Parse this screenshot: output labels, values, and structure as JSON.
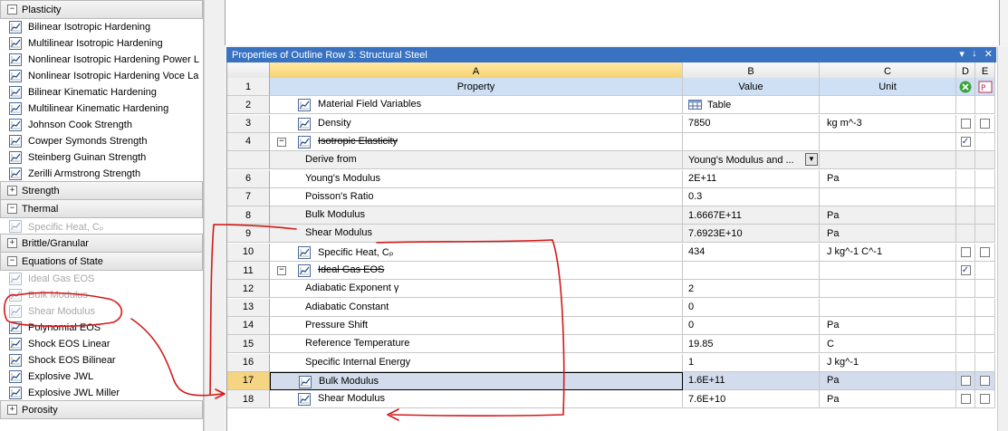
{
  "toolbox": {
    "items": [
      {
        "kind": "group",
        "label": "Plasticity",
        "expanded": true
      },
      {
        "kind": "item",
        "label": "Bilinear Isotropic Hardening"
      },
      {
        "kind": "item",
        "label": "Multilinear Isotropic Hardening"
      },
      {
        "kind": "item",
        "label": "Nonlinear Isotropic Hardening Power L"
      },
      {
        "kind": "item",
        "label": "Nonlinear Isotropic Hardening Voce La"
      },
      {
        "kind": "item",
        "label": "Bilinear Kinematic Hardening"
      },
      {
        "kind": "item",
        "label": "Multilinear Kinematic Hardening"
      },
      {
        "kind": "item",
        "label": "Johnson Cook Strength"
      },
      {
        "kind": "item",
        "label": "Cowper Symonds Strength"
      },
      {
        "kind": "item",
        "label": "Steinberg Guinan Strength"
      },
      {
        "kind": "item",
        "label": "Zerilli Armstrong Strength"
      },
      {
        "kind": "group",
        "label": "Strength",
        "expanded": false
      },
      {
        "kind": "group",
        "label": "Thermal",
        "expanded": true
      },
      {
        "kind": "item",
        "label": "Specific Heat, Cₚ",
        "disabled": true
      },
      {
        "kind": "group",
        "label": "Brittle/Granular",
        "expanded": false
      },
      {
        "kind": "group",
        "label": "Equations of State",
        "expanded": true
      },
      {
        "kind": "item",
        "label": "Ideal Gas EOS",
        "disabled": true
      },
      {
        "kind": "item",
        "label": "Bulk Modulus",
        "disabled": true
      },
      {
        "kind": "item",
        "label": "Shear Modulus",
        "disabled": true
      },
      {
        "kind": "item",
        "label": "Polynomial EOS"
      },
      {
        "kind": "item",
        "label": "Shock EOS Linear"
      },
      {
        "kind": "item",
        "label": "Shock EOS Bilinear"
      },
      {
        "kind": "item",
        "label": "Explosive JWL"
      },
      {
        "kind": "item",
        "label": "Explosive JWL Miller"
      },
      {
        "kind": "group",
        "label": "Porosity",
        "expanded": false
      }
    ]
  },
  "panel": {
    "title": "Properties of Outline Row 3: Structural Steel",
    "title_buttons": [
      "▾",
      " ↓ ",
      "✕"
    ]
  },
  "grid": {
    "column_letters": [
      "A",
      "B",
      "C",
      "D",
      "E"
    ],
    "rows": [
      {
        "num": "1",
        "property": "Property",
        "value": "Value",
        "unit": "Unit",
        "type": "header"
      },
      {
        "num": "2",
        "property": "Material Field Variables",
        "value": "Table",
        "unit": "",
        "icon": true,
        "value_icon": true,
        "type": "normal"
      },
      {
        "num": "3",
        "property": "Density",
        "value": "7850",
        "unit": "kg m^-3",
        "icon": true,
        "d": "box",
        "e": "box",
        "type": "normal"
      },
      {
        "num": "4",
        "property": "Isotropic Elasticity",
        "value": "",
        "unit": "",
        "icon": true,
        "toggle": "−",
        "strike": true,
        "d": "checked",
        "type": "normal"
      },
      {
        "num": "",
        "property": "Derive from",
        "value": "Young's Modulus and ...",
        "unit": "",
        "dropdown": true,
        "indent": true,
        "type": "alt"
      },
      {
        "num": "6",
        "property": "Young's Modulus",
        "value": "2E+11",
        "unit": "Pa",
        "indent": true,
        "type": "normal"
      },
      {
        "num": "7",
        "property": "Poisson's Ratio",
        "value": "0.3",
        "unit": "",
        "indent": true,
        "type": "normal"
      },
      {
        "num": "8",
        "property": "Bulk Modulus",
        "value": "1.6667E+11",
        "unit": "Pa",
        "indent": true,
        "type": "alt"
      },
      {
        "num": "9",
        "property": "Shear Modulus",
        "value": "7.6923E+10",
        "unit": "Pa",
        "indent": true,
        "type": "alt"
      },
      {
        "num": "10",
        "property": "Specific Heat, Cₚ",
        "value": "434",
        "unit": "J kg^-1 C^-1",
        "icon": true,
        "d": "box",
        "e": "box",
        "type": "normal"
      },
      {
        "num": "11",
        "property": "Ideal Gas EOS",
        "value": "",
        "unit": "",
        "icon": true,
        "toggle": "−",
        "strike": true,
        "d": "checked",
        "type": "normal"
      },
      {
        "num": "12",
        "property": "Adiabatic Exponent γ",
        "value": "2",
        "unit": "",
        "indent": true,
        "type": "normal"
      },
      {
        "num": "13",
        "property": "Adiabatic Constant",
        "value": "0",
        "unit": "",
        "indent": true,
        "type": "normal"
      },
      {
        "num": "14",
        "property": "Pressure Shift",
        "value": "0",
        "unit": "Pa",
        "indent": true,
        "type": "normal"
      },
      {
        "num": "15",
        "property": "Reference Temperature",
        "value": "19.85",
        "unit": "C",
        "indent": true,
        "type": "normal"
      },
      {
        "num": "16",
        "property": "Specific Internal Energy",
        "value": "1",
        "unit": "J kg^-1",
        "indent": true,
        "type": "normal"
      },
      {
        "num": "17",
        "property": "Bulk Modulus",
        "value": "1.6E+11",
        "unit": "Pa",
        "icon": true,
        "d": "box",
        "e": "box",
        "type": "selected"
      },
      {
        "num": "18",
        "property": "Shear Modulus",
        "value": "7.6E+10",
        "unit": "Pa",
        "icon": true,
        "d": "box",
        "e": "box",
        "type": "normal"
      }
    ]
  },
  "colors": {
    "title_bar": "#3972c0",
    "header_selected": "#f5cf6a",
    "property_row": "#cfe0f5",
    "selection": "#d3dced",
    "annotation_red": "#d21a1a"
  }
}
